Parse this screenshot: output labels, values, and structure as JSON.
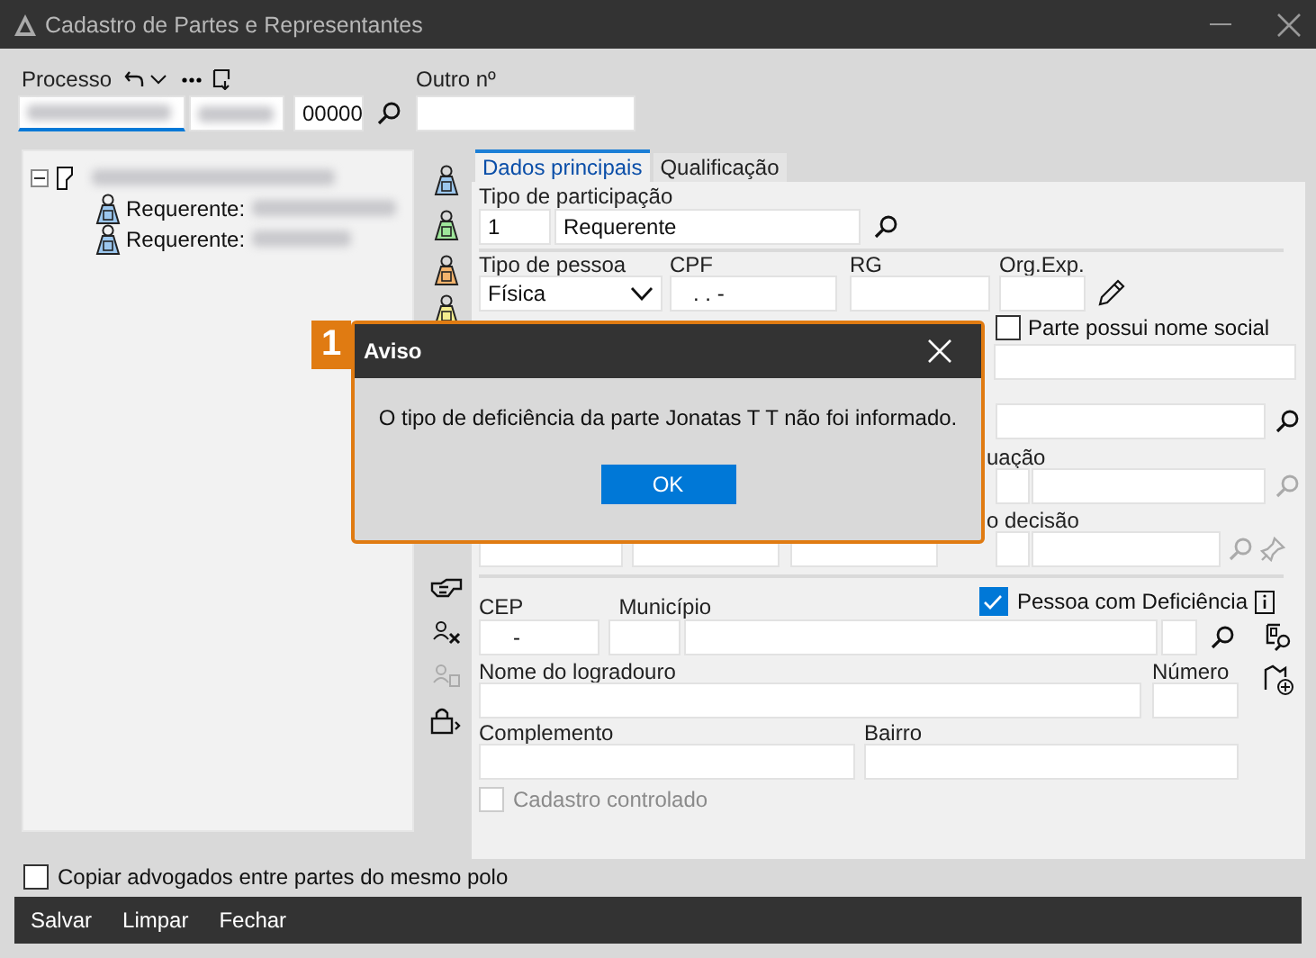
{
  "window": {
    "title": "Cadastro de Partes e Representantes"
  },
  "process": {
    "label": "Processo",
    "number_suffix": "00000",
    "other_label": "Outro nº"
  },
  "tree": {
    "expanded": true,
    "children": [
      {
        "label": "Requerente:"
      },
      {
        "label": "Requerente:"
      }
    ]
  },
  "tabs": [
    {
      "label": "Dados principais",
      "selected": true
    },
    {
      "label": "Qualificação",
      "selected": false
    }
  ],
  "form": {
    "participation": {
      "label": "Tipo de participação",
      "code": "1",
      "value": "Requerente"
    },
    "person_type": {
      "label": "Tipo de pessoa",
      "value": "Física"
    },
    "cpf": {
      "label": "CPF",
      "value": ". . -"
    },
    "rg": {
      "label": "RG"
    },
    "org_exp": {
      "label": "Org.Exp."
    },
    "social_name": {
      "label": "Parte possui nome social",
      "checked": false
    },
    "partial_label_1": "uação",
    "partial_label_2": "o decisão",
    "disability": {
      "label": "Pessoa com Deficiência",
      "checked": true
    },
    "cep": {
      "label": "CEP",
      "value": "-"
    },
    "city": {
      "label": "Município"
    },
    "street": {
      "label": "Nome do logradouro"
    },
    "number": {
      "label": "Número"
    },
    "complement": {
      "label": "Complemento"
    },
    "district": {
      "label": "Bairro"
    },
    "controlled": {
      "label": "Cadastro controlado",
      "checked": false,
      "disabled": true
    }
  },
  "dialog": {
    "marker": "1",
    "title": "Aviso",
    "message": "O tipo de deficiência da parte Jonatas T T não foi informado.",
    "button": "OK"
  },
  "copy_lawyers": {
    "label": "Copiar advogados entre partes do mesmo polo",
    "checked": false
  },
  "actions": [
    "Salvar",
    "Limpar",
    "Fechar"
  ]
}
